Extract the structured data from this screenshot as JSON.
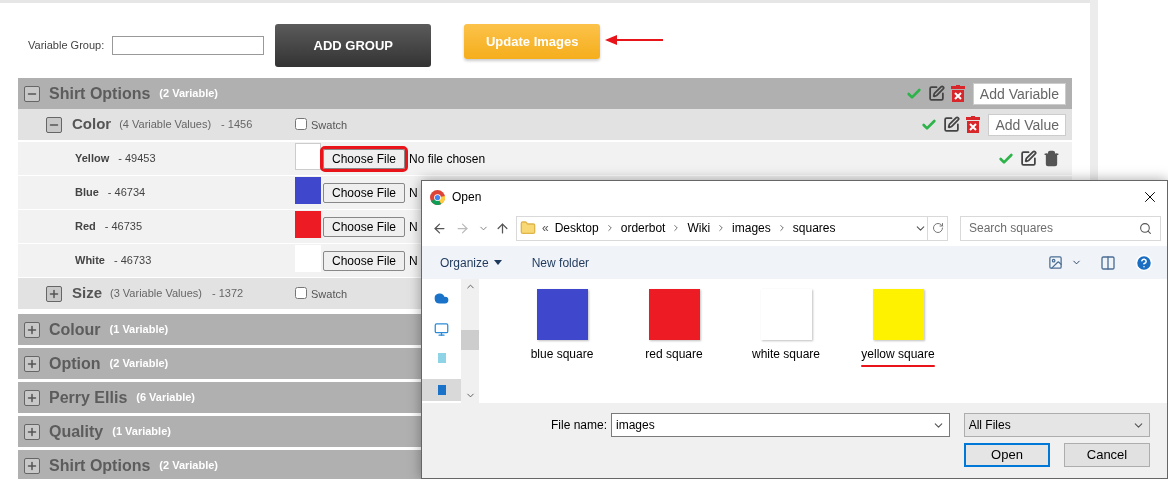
{
  "form": {
    "label": "Variable Group:",
    "add_button": "ADD GROUP",
    "update_button": "Update Images"
  },
  "groups": [
    {
      "name": "Shirt Options",
      "count": "(2 Variable)",
      "expanded": true,
      "add_button": "Add Variable",
      "variables": [
        {
          "name": "Color",
          "count": "(4 Variable Values)",
          "id": "- 1456",
          "swatch_label": "Swatch",
          "swatch_checked": false,
          "expanded": true,
          "add_button": "Add Value",
          "values": [
            {
              "name": "Yellow",
              "id": "- 49453",
              "button": "Choose File",
              "status": "No file chosen",
              "highlighted": true,
              "actions": true
            },
            {
              "name": "Blue",
              "id": "- 46734",
              "color": "#3f48cc",
              "button": "Choose File",
              "status": "N",
              "highlighted": false
            },
            {
              "name": "Red",
              "id": "- 46735",
              "color": "#ed1c24",
              "button": "Choose File",
              "status": "N",
              "highlighted": false
            },
            {
              "name": "White",
              "id": "- 46733",
              "color": "#ffffff",
              "button": "Choose File",
              "status": "N",
              "highlighted": false
            }
          ]
        },
        {
          "name": "Size",
          "count": "(3 Variable Values)",
          "id": "- 1372",
          "swatch_label": "Swatch",
          "swatch_checked": false,
          "expanded": false
        }
      ]
    },
    {
      "name": "Colour",
      "count": "(1 Variable)",
      "expanded": false
    },
    {
      "name": "Option",
      "count": "(2 Variable)",
      "expanded": false
    },
    {
      "name": "Perry Ellis",
      "count": "(6 Variable)",
      "expanded": false
    },
    {
      "name": "Quality",
      "count": "(1 Variable)",
      "expanded": false
    },
    {
      "name": "Shirt Options",
      "count": "(2 Variable)",
      "expanded": false
    }
  ],
  "dialog": {
    "title": "Open",
    "path_prefix": "«",
    "path": [
      "Desktop",
      "orderbot",
      "Wiki",
      "images",
      "squares"
    ],
    "search_placeholder": "Search squares",
    "organize": "Organize",
    "new_folder": "New folder",
    "files": [
      {
        "name": "blue square",
        "color": "#3f48cc",
        "annotated": false
      },
      {
        "name": "red square",
        "color": "#ed1c24",
        "annotated": false
      },
      {
        "name": "white square",
        "color": "#ffffff",
        "annotated": false
      },
      {
        "name": "yellow square",
        "color": "#fff200",
        "annotated": true
      }
    ],
    "file_name_label": "File name:",
    "file_name": "images",
    "filter": "All Files",
    "open_button": "Open",
    "cancel_button": "Cancel"
  }
}
